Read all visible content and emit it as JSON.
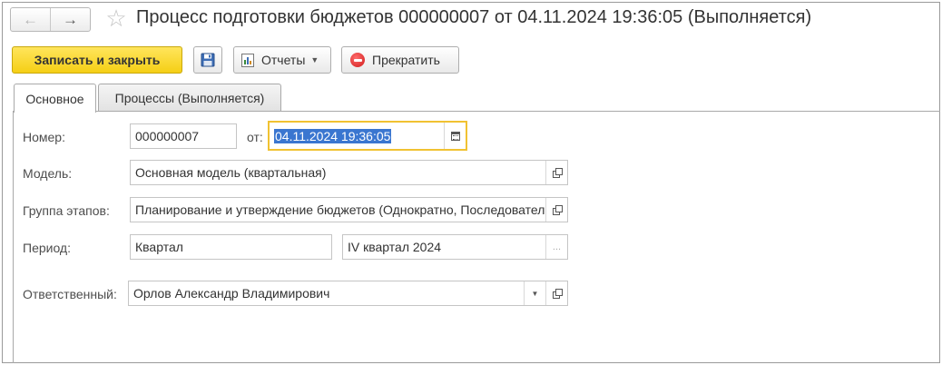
{
  "window": {
    "title": "Процесс подготовки бюджетов 000000007 от 04.11.2024 19:36:05 (Выполняется)"
  },
  "nav": {
    "back": "←",
    "forward": "→",
    "favorite": "☆"
  },
  "toolbar": {
    "save_close_label": "Записать и закрыть",
    "reports_label": "Отчеты",
    "reports_caret": "▼",
    "stop_label": "Прекратить"
  },
  "tabs": [
    {
      "label": "Основное",
      "active": true
    },
    {
      "label": "Процессы (Выполняется)",
      "active": false
    }
  ],
  "form": {
    "number_label": "Номер:",
    "number_value": "000000007",
    "from_label": "от:",
    "date_value": "04.11.2024 19:36:05",
    "model_label": "Модель:",
    "model_value": "Основная модель (квартальная)",
    "stage_group_label": "Группа этапов:",
    "stage_group_value": "Планирование и утверждение бюджетов (Однократно, Последовательно)",
    "period_label": "Период:",
    "period_type_value": "Квартал",
    "period_value": "IV квартал 2024",
    "period_select": "...",
    "responsible_label": "Ответственный:",
    "responsible_value": "Орлов Александр Владимирович",
    "dropdown_caret": "▼"
  },
  "colors": {
    "primary_button": "#f5cf15",
    "focus_border": "#f1c232",
    "selection": "#3a76d0",
    "stop_icon": "#d01c1c"
  }
}
